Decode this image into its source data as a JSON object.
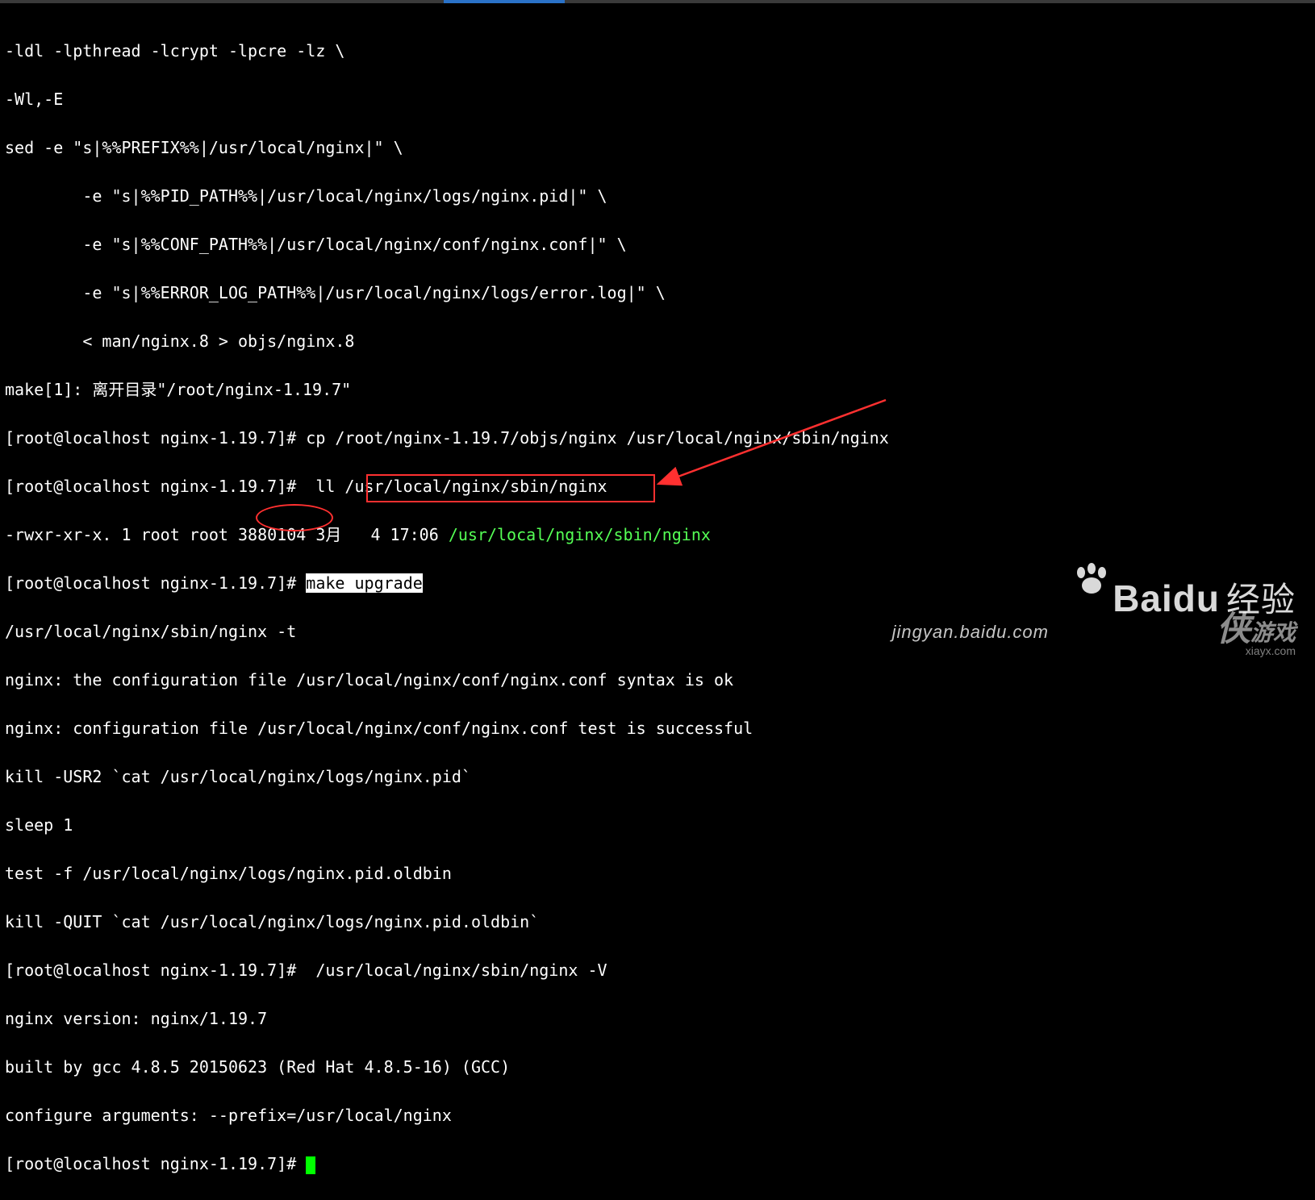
{
  "lines": {
    "l01": "-ldl -lpthread -lcrypt -lpcre -lz \\",
    "l02": "-Wl,-E",
    "l03": "sed -e \"s|%%PREFIX%%|/usr/local/nginx|\" \\",
    "l04": "        -e \"s|%%PID_PATH%%|/usr/local/nginx/logs/nginx.pid|\" \\",
    "l05": "        -e \"s|%%CONF_PATH%%|/usr/local/nginx/conf/nginx.conf|\" \\",
    "l06": "        -e \"s|%%ERROR_LOG_PATH%%|/usr/local/nginx/logs/error.log|\" \\",
    "l07": "        < man/nginx.8 > objs/nginx.8",
    "l08": "make[1]: 离开目录\"/root/nginx-1.19.7\"",
    "l09a": "[root@localhost nginx-1.19.7]# cp /root/nginx-1.19.7/objs/nginx /usr/local/nginx/sbin/nginx",
    "l10a": "[root@localhost nginx-1.19.7]#  ll /usr/local/nginx/sbin/nginx",
    "l11a": "-rwxr-xr-x. 1 root root 3880104 3月   4 17:06 ",
    "l11b": "/usr/local/nginx/sbin/nginx",
    "l12a": "[root@localhost nginx-1.19.7]# ",
    "l12b": "make upgrade",
    "l13": "/usr/local/nginx/sbin/nginx -t",
    "l14": "nginx: the configuration file /usr/local/nginx/conf/nginx.conf syntax is ok",
    "l15": "nginx: configuration file /usr/local/nginx/conf/nginx.conf test is successful",
    "l16": "kill -USR2 `cat /usr/local/nginx/logs/nginx.pid`",
    "l17": "sleep 1",
    "l18": "test -f /usr/local/nginx/logs/nginx.pid.oldbin",
    "l19": "kill -QUIT `cat /usr/local/nginx/logs/nginx.pid.oldbin`",
    "l20": "[root@localhost nginx-1.19.7]#  /usr/local/nginx/sbin/nginx -V",
    "l21": "nginx version: nginx/1.19.7",
    "l22": "built by gcc 4.8.5 20150623 (Red Hat 4.8.5-16) (GCC)",
    "l23": "configure arguments: --prefix=/usr/local/nginx",
    "l24": "[root@localhost nginx-1.19.7]# "
  },
  "annotations": {
    "highlighted_command": "make upgrade",
    "boxed_command": "/usr/local/nginx/sbin/nginx -V",
    "circled_version": "1.19.7",
    "executable_path_green": "/usr/local/nginx/sbin/nginx"
  },
  "watermarks": {
    "baidu": "Bai",
    "baidu2": "du",
    "baidu_zh": "经验",
    "baidu_url": "jingyan.baidu.com",
    "xia": "侠",
    "xia2": "游戏",
    "xia_url": "xiayx.com"
  }
}
